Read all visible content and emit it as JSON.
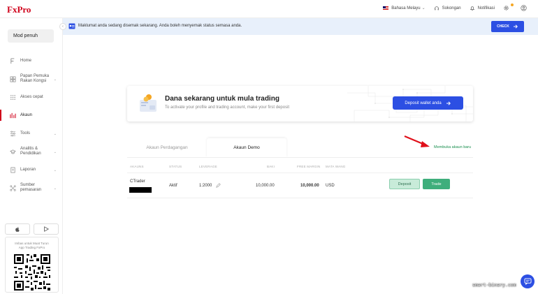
{
  "header": {
    "logo": "FxPro",
    "language": "Bahasa Melayu",
    "support": "Sokongan",
    "notifications": "Notifikasi"
  },
  "sidebar": {
    "mode_label": "Mod penuh",
    "items": [
      {
        "label": "Home",
        "icon": "home-icon"
      },
      {
        "label": "Papan Pemuka Rakan Kongsi",
        "icon": "dashboard-icon"
      },
      {
        "label": "Akses cepat",
        "icon": "grid-icon"
      },
      {
        "label": "Akaun",
        "icon": "accounts-icon"
      },
      {
        "label": "Tools",
        "icon": "tools-icon"
      },
      {
        "label": "Analitis & Pendidikan",
        "icon": "analytics-icon"
      },
      {
        "label": "Laporan",
        "icon": "report-icon"
      },
      {
        "label": "Sumber pemasaran",
        "icon": "marketing-icon"
      }
    ],
    "app_text": "Imbas untuk Muat Turun App Trading FxPro"
  },
  "notice": {
    "text": "Maklumat anda sedang disemak sekarang. Anda boleh menyemak status semasa anda.",
    "button": "CHECK"
  },
  "promo": {
    "title": "Dana sekarang untuk mula trading",
    "subtitle": "To activate your profile and trading account, make your first deposit",
    "button": "Deposit wallet anda"
  },
  "tabs": {
    "trading": "Akaun Perdagangan",
    "demo": "Akaun Demo"
  },
  "new_account_link": "Membuka akaun baru",
  "table": {
    "headers": [
      "AKAUNS",
      "STATUS",
      "LEVERAGE",
      "BAKI",
      "FREE MARGIN",
      "MATA WANG"
    ],
    "row": {
      "platform": "CTrader",
      "status": "Aktif",
      "leverage": "1:2000",
      "balance": "10,000.00",
      "free_margin": "10,000.00",
      "currency": "USD",
      "deposit": "Deposit",
      "trade": "Trade"
    }
  },
  "watermark": "smart-binary.com",
  "colors": {
    "brand": "#d0021b",
    "primary": "#2c4fe3",
    "success": "#3fae7c"
  }
}
